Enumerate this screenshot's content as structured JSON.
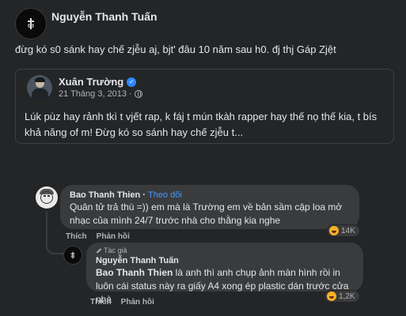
{
  "post": {
    "author": "Nguyễn Thanh Tuấn",
    "text": "đừg kó s0 sánk hay chế zjễu aj, bjt' đâu 10 năm sau h0. đj thj Gáp Zjệt",
    "shared": {
      "author": "Xuân Trường",
      "date": "21 Tháng 3, 2013",
      "audience_icon": "globe-icon",
      "verified_icon": "verified-badge-icon",
      "text": "Lúk pùz hay rảnh tkì t vjết rap, k fáj t mún tkàh rapper hay thế nọ thế kia, t bís khả năng of m! Đừg kó so sánh hay chế zjễu t..."
    }
  },
  "comments": [
    {
      "author": "Bao Thanh Thien",
      "follow_label": "Theo dõi",
      "separator": " · ",
      "text": "Quân tử trả thù =)) em mà là Trường em về bản sầm cập loa mở nhạc của mình 24/7 trước nhà cho thằng kia nghe",
      "like_label": "Thích",
      "reply_label": "Phản hồi",
      "reaction_icon": "haha-icon",
      "reaction_count": "14K"
    }
  ],
  "reply": {
    "author_tag": "Tác giả",
    "author": "Nguyễn Thanh Tuấn",
    "mention": "Bao Thanh Thien",
    "text": " là anh thì anh chụp ảnh màn hình rồi in luôn cái status này ra giấy A4 xong ép plastic dán trước cửa nhà",
    "like_label": "Thích",
    "reply_label": "Phản hồi",
    "reaction_icon": "haha-icon",
    "reaction_count": "1,2K"
  },
  "colors": {
    "background": "#242526",
    "bubble": "#3a3b3c",
    "link": "#4599ff",
    "secondary_text": "#b0b3b8"
  }
}
